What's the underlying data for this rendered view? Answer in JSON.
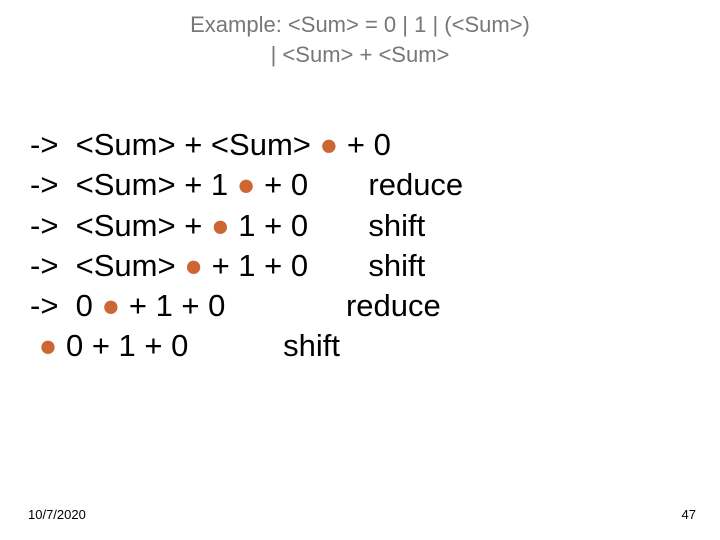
{
  "header": {
    "line1": "Example:  <Sum> = 0 | 1 | (<Sum>)",
    "line2": "| <Sum> + <Sum>"
  },
  "dot": "●",
  "steps": [
    {
      "a": "->  <Sum> + <Sum> ",
      "b": " + 0",
      "action": ""
    },
    {
      "a": "->  <Sum> + 1 ",
      "b": " + 0       reduce",
      "action": ""
    },
    {
      "a": "->  <Sum> + ",
      "b": " 1 + 0       shift",
      "action": ""
    },
    {
      "a": "->  <Sum> ",
      "b": " + 1 + 0       shift",
      "action": ""
    },
    {
      "a": "->  0 ",
      "b": " + 1 + 0              reduce",
      "action": ""
    },
    {
      "a": " ",
      "b": " 0 + 1 + 0           shift",
      "action": ""
    }
  ],
  "footer": {
    "date": "10/7/2020",
    "page": "47"
  }
}
